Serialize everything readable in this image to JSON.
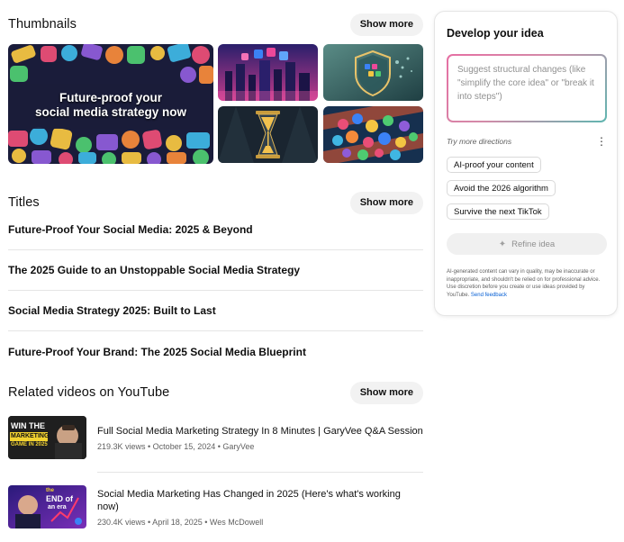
{
  "thumbnails": {
    "heading": "Thumbnails",
    "show_more": "Show more",
    "main_caption_line1": "Future-proof your",
    "main_caption_line2": "social media strategy now"
  },
  "titles": {
    "heading": "Titles",
    "show_more": "Show more",
    "items": [
      "Future-Proof Your Social Media: 2025 & Beyond",
      "The 2025 Guide to an Unstoppable Social Media Strategy",
      "Social Media Strategy 2025: Built to Last",
      "Future-Proof Your Brand: The 2025 Social Media Blueprint"
    ]
  },
  "related": {
    "heading": "Related videos on YouTube",
    "show_more": "Show more",
    "videos": [
      {
        "title": "Full Social Media Marketing Strategy In 8 Minutes | GaryVee Q&A Session",
        "meta": "219.3K views • October 15, 2024 • GaryVee",
        "thumb_line1": "WIN THE",
        "thumb_line2": "MARKETING",
        "thumb_line3": "GAME IN 2025"
      },
      {
        "title": "Social Media Marketing Has Changed in 2025 (Here's what's working now)",
        "meta": "230.4K views • April 18, 2025 • Wes McDowell",
        "thumb_line1": "the",
        "thumb_line2": "END of",
        "thumb_line3": "an era"
      }
    ]
  },
  "panel": {
    "title": "Develop your idea",
    "placeholder": "Suggest structural changes (like \"simplify the core idea\" or \"break it into steps\")",
    "try_more": "Try more directions",
    "kebab": "⋮",
    "chips": [
      "AI-proof your content",
      "Avoid the 2026 algorithm",
      "Survive the next TikTok"
    ],
    "refine_label": "Refine idea",
    "refine_icon": "sparkle-icon",
    "disclaimer": "AI-generated content can vary in quality, may be inaccurate or inappropriate, and shouldn't be relied on for professional advice. Use discretion before you create or use ideas provided by YouTube.",
    "feedback_link": "Send feedback"
  },
  "colors": {
    "chip_bg": "#f2f2f2",
    "link": "#065fd4",
    "meta": "#606060",
    "gradient_pink": "#e66fa3",
    "gradient_teal": "#5fb6b0"
  }
}
